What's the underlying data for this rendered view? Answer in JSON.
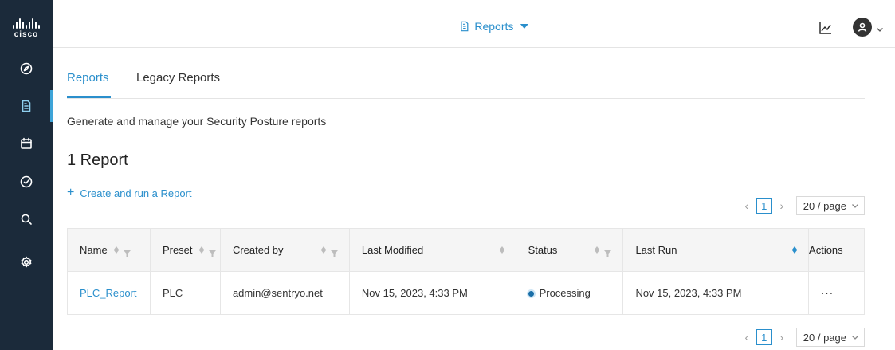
{
  "brand": {
    "logo_text": "cisco"
  },
  "topbar": {
    "page_menu_label": "Reports"
  },
  "tabs": [
    {
      "label": "Reports",
      "active": true
    },
    {
      "label": "Legacy Reports",
      "active": false
    }
  ],
  "description": "Generate and manage your Security Posture reports",
  "report_count": "1 Report",
  "create_label": "Create and run a Report",
  "pagination": {
    "current_page": "1",
    "page_size": "20 / page"
  },
  "table": {
    "columns": [
      "Name",
      "Preset",
      "Created by",
      "Last Modified",
      "Status",
      "Last Run",
      "Actions"
    ],
    "rows": [
      {
        "name": "PLC_Report",
        "preset": "PLC",
        "created_by": "admin@sentryo.net",
        "last_modified": "Nov 15, 2023, 4:33 PM",
        "status": "Processing",
        "last_run": "Nov 15, 2023, 4:33 PM",
        "actions": "···"
      }
    ]
  },
  "colors": {
    "sidebar": "#1b2a3a",
    "accent": "#2a8fcc",
    "status_processing": "#1b6fa8"
  }
}
